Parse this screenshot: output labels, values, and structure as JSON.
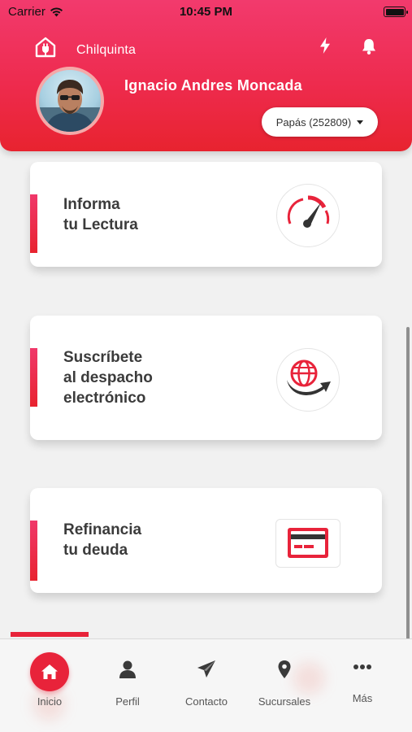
{
  "status_bar": {
    "carrier": "Carrier",
    "time": "10:45 PM"
  },
  "header": {
    "brand": "Chilquinta",
    "user_name": "Ignacio Andres Moncada",
    "account_selector": "Papás (252809)",
    "icons": {
      "logo": "house-plug-icon",
      "power": "bolt-icon",
      "notifications": "bell-icon"
    }
  },
  "cards": [
    {
      "title_lines": [
        "Informa",
        "tu Lectura"
      ],
      "icon": "speedometer-icon"
    },
    {
      "title_lines": [
        "Suscríbete",
        "al despacho",
        "electrónico"
      ],
      "icon": "globe-arrow-icon"
    },
    {
      "title_lines": [
        "Refinancia",
        "tu deuda"
      ],
      "icon": "credit-card-icon"
    }
  ],
  "bottom_nav": [
    {
      "label": "Inicio",
      "icon": "home-icon",
      "active": true
    },
    {
      "label": "Perfil",
      "icon": "user-icon",
      "active": false
    },
    {
      "label": "Contacto",
      "icon": "paper-plane-icon",
      "active": false
    },
    {
      "label": "Sucursales",
      "icon": "map-pin-icon",
      "active": false
    },
    {
      "label": "Más",
      "icon": "more-dots-icon",
      "active": false
    }
  ],
  "colors": {
    "brand_red": "#e8233a",
    "brand_pink": "#f23a6d",
    "text_dark": "#3b3b3b"
  }
}
